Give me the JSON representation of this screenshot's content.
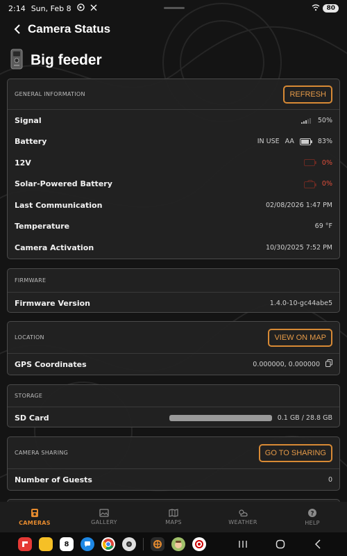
{
  "status_bar": {
    "time": "2:14",
    "date": "Sun, Feb 8",
    "battery": "80"
  },
  "header": {
    "title": "Camera Status"
  },
  "camera": {
    "name": "Big feeder"
  },
  "general": {
    "section_label": "GENERAL INFORMATION",
    "refresh_label": "REFRESH",
    "signal_label": "Signal",
    "signal_value": "50%",
    "battery_label": "Battery",
    "battery_in_use": "IN USE",
    "battery_type": "AA",
    "battery_value": "83%",
    "v12_label": "12V",
    "v12_value": "0%",
    "solar_label": "Solar-Powered Battery",
    "solar_value": "0%",
    "last_comm_label": "Last Communication",
    "last_comm_value": "02/08/2026 1:47 PM",
    "temperature_label": "Temperature",
    "temperature_value": "69 °F",
    "activation_label": "Camera Activation",
    "activation_value": "10/30/2025 7:52 PM"
  },
  "firmware": {
    "section_label": "FIRMWARE",
    "version_label": "Firmware Version",
    "version_value": "1.4.0-10-gc44abe5"
  },
  "location": {
    "section_label": "LOCATION",
    "view_map_label": "VIEW ON MAP",
    "gps_label": "GPS Coordinates",
    "gps_value": "0.000000, 0.000000"
  },
  "storage": {
    "section_label": "STORAGE",
    "sd_label": "SD Card",
    "sd_value": "0.1 GB / 28.8 GB",
    "used_fraction": 0.0035
  },
  "sharing": {
    "section_label": "CAMERA SHARING",
    "go_label": "GO TO SHARING",
    "guests_label": "Number of Guests",
    "guests_value": "0"
  },
  "bottom_nav": {
    "cameras": "CAMERAS",
    "gallery": "GALLERY",
    "maps": "MAPS",
    "weather": "WEATHER",
    "help": "HELP"
  },
  "colors": {
    "accent": "#e58a2e",
    "alert": "#e04e3a"
  },
  "dock": {
    "calendar_day": "8"
  }
}
